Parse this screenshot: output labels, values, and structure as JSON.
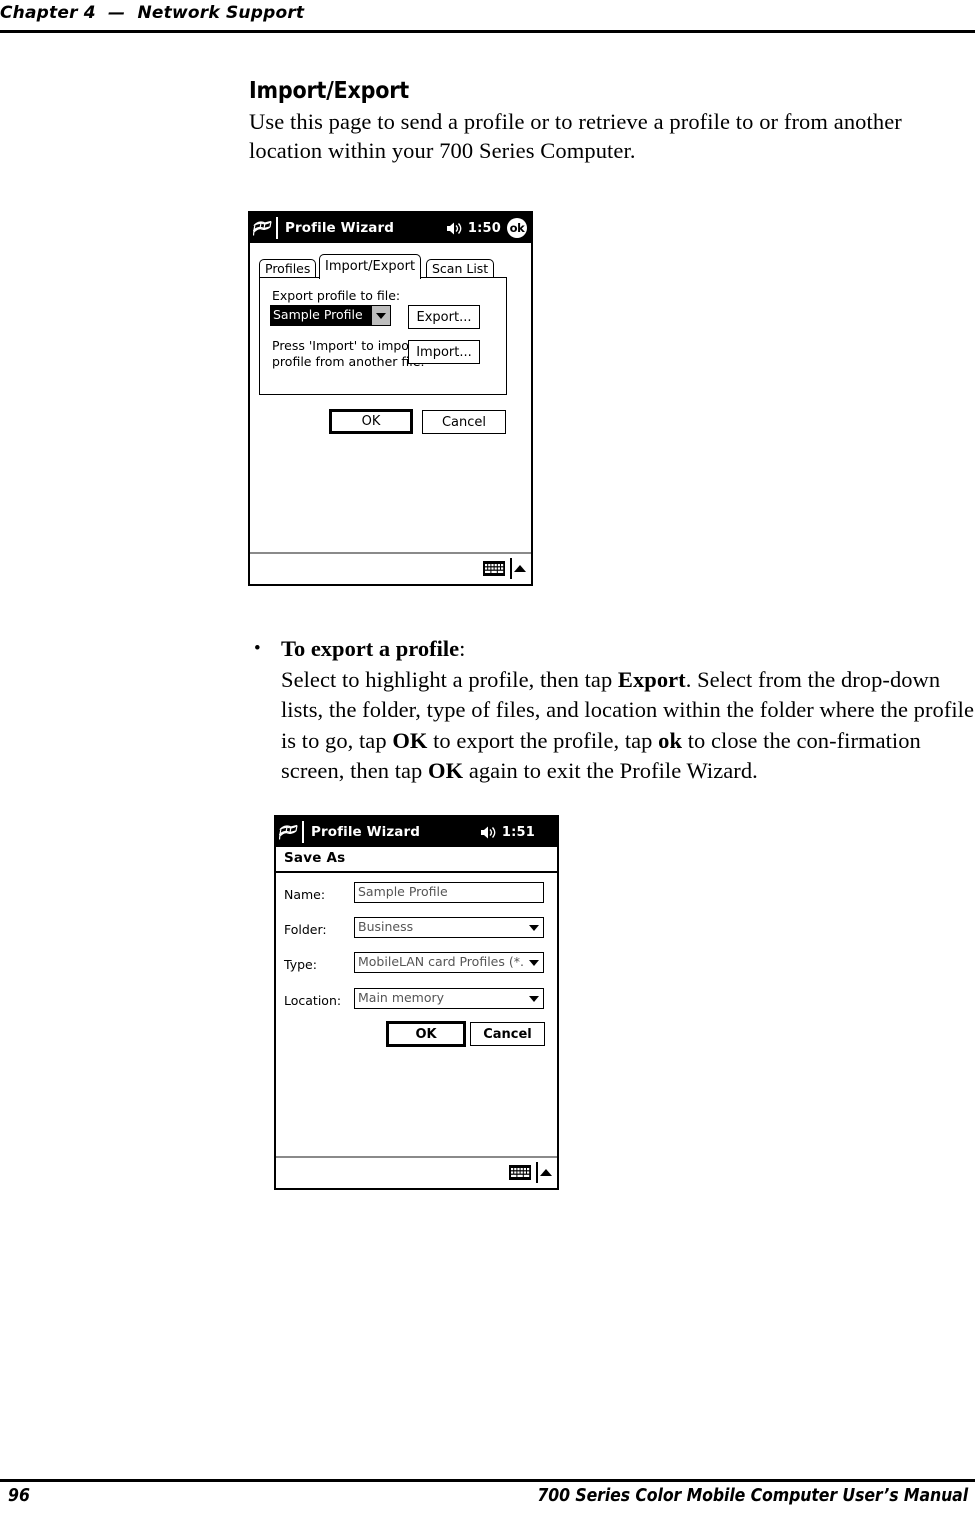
{
  "running_head": "Chapter 4  —  Network Support",
  "section": {
    "title": "Import/Export",
    "paragraph": "Use this page to send a profile or to retrieve a profile to or from another location within your 700 Series Computer."
  },
  "bullet": {
    "marker": "•",
    "heading": "To export a profile",
    "heading_colon": ":",
    "body_1": "Select to highlight a profile, then tap ",
    "body_b1": "Export",
    "body_2": ". Select from the drop-down lists, the folder, type of files, and location within the folder where the profile is to go, tap ",
    "body_b2": "OK",
    "body_3": " to export the profile, tap ",
    "body_b3": "ok",
    "body_4": " to close the con-firmation screen, then tap ",
    "body_b4": "OK",
    "body_5": " again to exit the Profile Wizard."
  },
  "footer": {
    "page_number": "96",
    "manual_title": "700 Series Color Mobile Computer User’s Manual"
  },
  "screenshot_1": {
    "titlebar": {
      "app_title": "Profile Wizard",
      "clock": "1:50",
      "ok_label": "ok",
      "logo_icon": "windows-flag-icon",
      "volume_icon": "speaker-icon"
    },
    "tabs": [
      {
        "label": "Profiles",
        "active": false
      },
      {
        "label": "Import/Export",
        "active": true
      },
      {
        "label": "Scan List",
        "active": false
      }
    ],
    "panel": {
      "export_label": "Export profile to file:",
      "profile_combo_value": "Sample Profile",
      "export_button": "Export...",
      "import_label_line1": "Press 'Import' to import a",
      "import_label_line2": "profile from another file:",
      "import_button": "Import..."
    },
    "buttons": {
      "ok": "OK",
      "cancel": "Cancel"
    },
    "sipbar": {
      "keyboard_icon": "keyboard-icon",
      "arrow_icon": "up-arrow-icon"
    }
  },
  "screenshot_2": {
    "titlebar": {
      "app_title": "Profile Wizard",
      "clock": "1:51",
      "logo_icon": "windows-flag-icon",
      "volume_icon": "speaker-icon"
    },
    "dialog_header": "Save As",
    "fields": [
      {
        "label": "Name:",
        "value": "Sample Profile",
        "control": "textbox"
      },
      {
        "label": "Folder:",
        "value": "Business",
        "control": "combobox"
      },
      {
        "label": "Type:",
        "value": "MobileLAN card Profiles (*.",
        "control": "combobox"
      },
      {
        "label": "Location:",
        "value": "Main memory",
        "control": "combobox"
      }
    ],
    "buttons": {
      "ok": "OK",
      "cancel": "Cancel"
    },
    "sipbar": {
      "keyboard_icon": "keyboard-icon",
      "arrow_icon": "up-arrow-icon"
    }
  }
}
